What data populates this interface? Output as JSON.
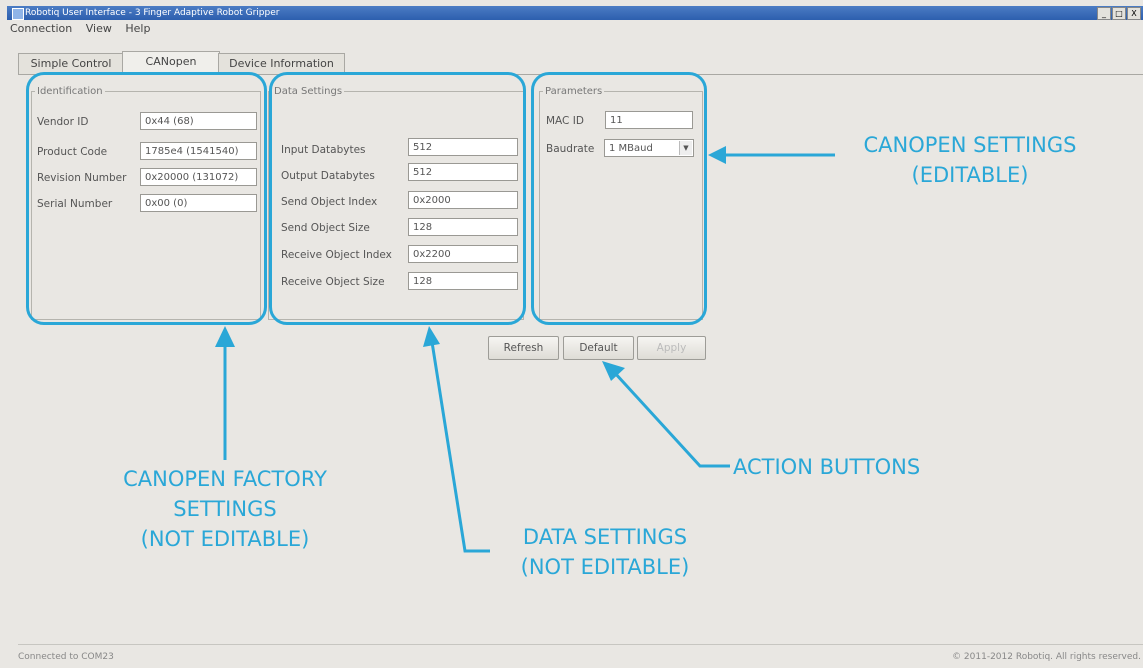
{
  "window": {
    "title": "Robotiq User Interface - 3 Finger Adaptive Robot Gripper",
    "controls": [
      "_",
      "□",
      "X"
    ]
  },
  "menu": [
    "Connection",
    "View",
    "Help"
  ],
  "tabs": [
    {
      "label": "Simple Control"
    },
    {
      "label": "CANopen"
    },
    {
      "label": "Device Information"
    }
  ],
  "identification": {
    "legend": "Identification",
    "vendor_id": {
      "label": "Vendor ID",
      "value": "0x44 (68)"
    },
    "product_code": {
      "label": "Product Code",
      "value": "1785e4 (1541540)"
    },
    "revision_number": {
      "label": "Revision Number",
      "value": "0x20000 (131072)"
    },
    "serial_number": {
      "label": "Serial Number",
      "value": "0x00 (0)"
    }
  },
  "data_settings": {
    "legend": "Data Settings",
    "input_databytes": {
      "label": "Input Databytes",
      "value": "512"
    },
    "output_databytes": {
      "label": "Output Databytes",
      "value": "512"
    },
    "send_object_index": {
      "label": "Send Object Index",
      "value": "0x2000"
    },
    "send_object_size": {
      "label": "Send Object Size",
      "value": "128"
    },
    "receive_object_index": {
      "label": "Receive Object Index",
      "value": "0x2200"
    },
    "receive_object_size": {
      "label": "Receive Object Size",
      "value": "128"
    }
  },
  "parameters": {
    "legend": "Parameters",
    "mac_id": {
      "label": "MAC ID",
      "value": "11"
    },
    "baudrate": {
      "label": "Baudrate",
      "value": "1 MBaud"
    }
  },
  "buttons": {
    "refresh": "Refresh",
    "default": "Default",
    "apply": "Apply"
  },
  "annotations": {
    "canopen_settings": [
      "CANOPEN SETTINGS",
      "(EDITABLE)"
    ],
    "factory_settings": [
      "CANOPEN FACTORY",
      "SETTINGS",
      "(NOT EDITABLE)"
    ],
    "data_settings": [
      "DATA SETTINGS",
      "(NOT EDITABLE)"
    ],
    "action_buttons": [
      "ACTION BUTTONS"
    ],
    "accent_color": "#2aa7d7"
  },
  "status": {
    "left": "Connected to COM23",
    "right": "© 2011-2012 Robotiq. All rights reserved."
  }
}
